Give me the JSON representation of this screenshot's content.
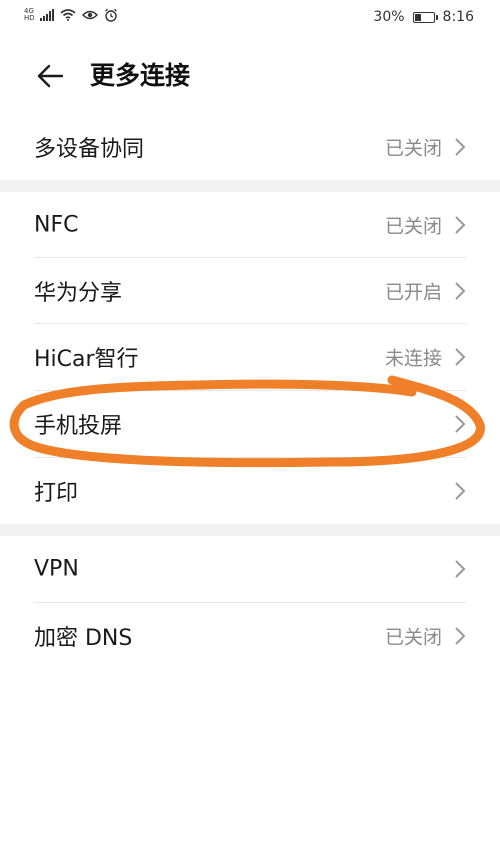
{
  "status_bar": {
    "network": "4G",
    "network_sub": "HD",
    "battery_percent": "30%",
    "battery_level": 0.3,
    "time": "8:16",
    "icons": [
      "signal-icon",
      "wifi-icon",
      "eye-icon",
      "alarm-icon",
      "battery-icon"
    ]
  },
  "header": {
    "title": "更多连接",
    "back_icon": "arrow-left-icon"
  },
  "sections": [
    {
      "items": [
        {
          "label": "多设备协同",
          "value": "已关闭"
        }
      ]
    },
    {
      "items": [
        {
          "label": "NFC",
          "value": "已关闭"
        },
        {
          "label": "华为分享",
          "value": "已开启"
        },
        {
          "label": "HiCar智行",
          "value": "未连接"
        },
        {
          "label": "手机投屏",
          "value": ""
        },
        {
          "label": "打印",
          "value": ""
        }
      ]
    },
    {
      "items": [
        {
          "label": "VPN",
          "value": ""
        },
        {
          "label": "加密 DNS",
          "value": "已关闭"
        }
      ]
    }
  ],
  "annotation_color": "#f07f2a",
  "divider_color": "#e6e6e6",
  "section_gap_color": "#f2f2f2"
}
